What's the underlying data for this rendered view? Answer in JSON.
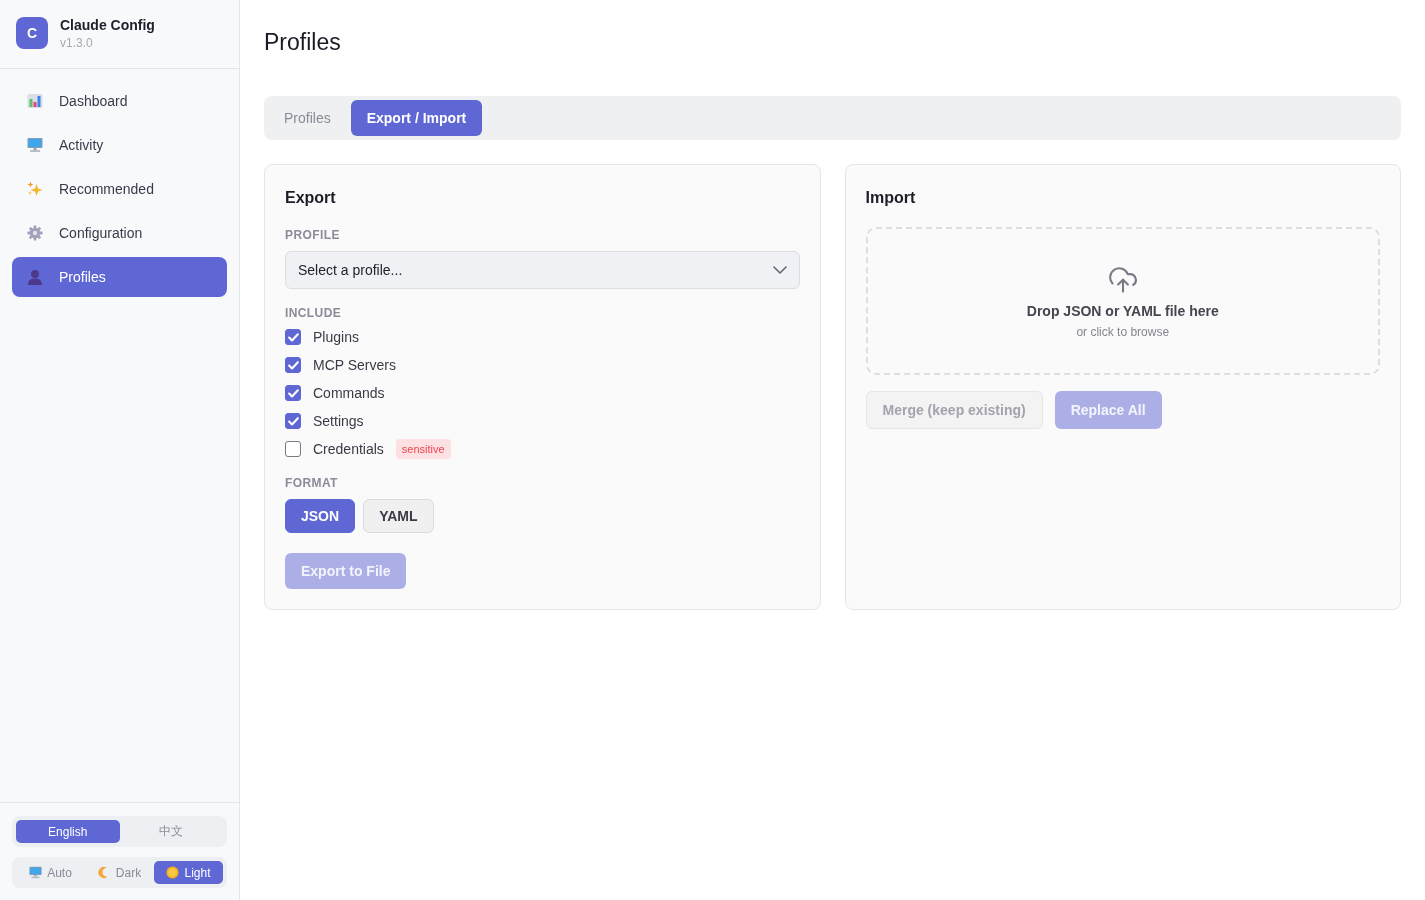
{
  "app": {
    "logo": "C",
    "name": "Claude Config",
    "version": "v1.3.0"
  },
  "sidebar": {
    "items": [
      {
        "label": "Dashboard",
        "selected": false
      },
      {
        "label": "Activity",
        "selected": false
      },
      {
        "label": "Recommended",
        "selected": false
      },
      {
        "label": "Configuration",
        "selected": false
      },
      {
        "label": "Profiles",
        "selected": true
      }
    ]
  },
  "language": [
    {
      "label": "English",
      "selected": true
    },
    {
      "label": "中文",
      "selected": false
    }
  ],
  "theme": [
    {
      "label": "Auto",
      "selected": false
    },
    {
      "label": "Dark",
      "selected": false
    },
    {
      "label": "Light",
      "selected": true
    }
  ],
  "page": {
    "title": "Profiles"
  },
  "tabs": [
    {
      "label": "Profiles",
      "selected": false
    },
    {
      "label": "Export / Import",
      "selected": true
    }
  ],
  "export": {
    "title": "Export",
    "profile_label": "PROFILE",
    "profile_select": {
      "value": "Select a profile..."
    },
    "include_label": "INCLUDE",
    "include": [
      {
        "label": "Plugins",
        "checked": true
      },
      {
        "label": "MCP Servers",
        "checked": true
      },
      {
        "label": "Commands",
        "checked": true
      },
      {
        "label": "Settings",
        "checked": true
      },
      {
        "label": "Credentials",
        "checked": false,
        "badge": "sensitive"
      }
    ],
    "format_label": "FORMAT",
    "formats": [
      {
        "label": "JSON",
        "selected": true
      },
      {
        "label": "YAML",
        "selected": false
      }
    ],
    "export_button": {
      "label": "Export to File",
      "kind": "primary",
      "disabled": true
    }
  },
  "import": {
    "title": "Import",
    "dropzone": {
      "title": "Drop JSON or YAML file here",
      "subtitle": "or click to browse"
    },
    "buttons": [
      {
        "label": "Merge (keep existing)",
        "kind": "secondary",
        "disabled": true
      },
      {
        "label": "Replace All",
        "kind": "primary",
        "disabled": true
      }
    ]
  }
}
